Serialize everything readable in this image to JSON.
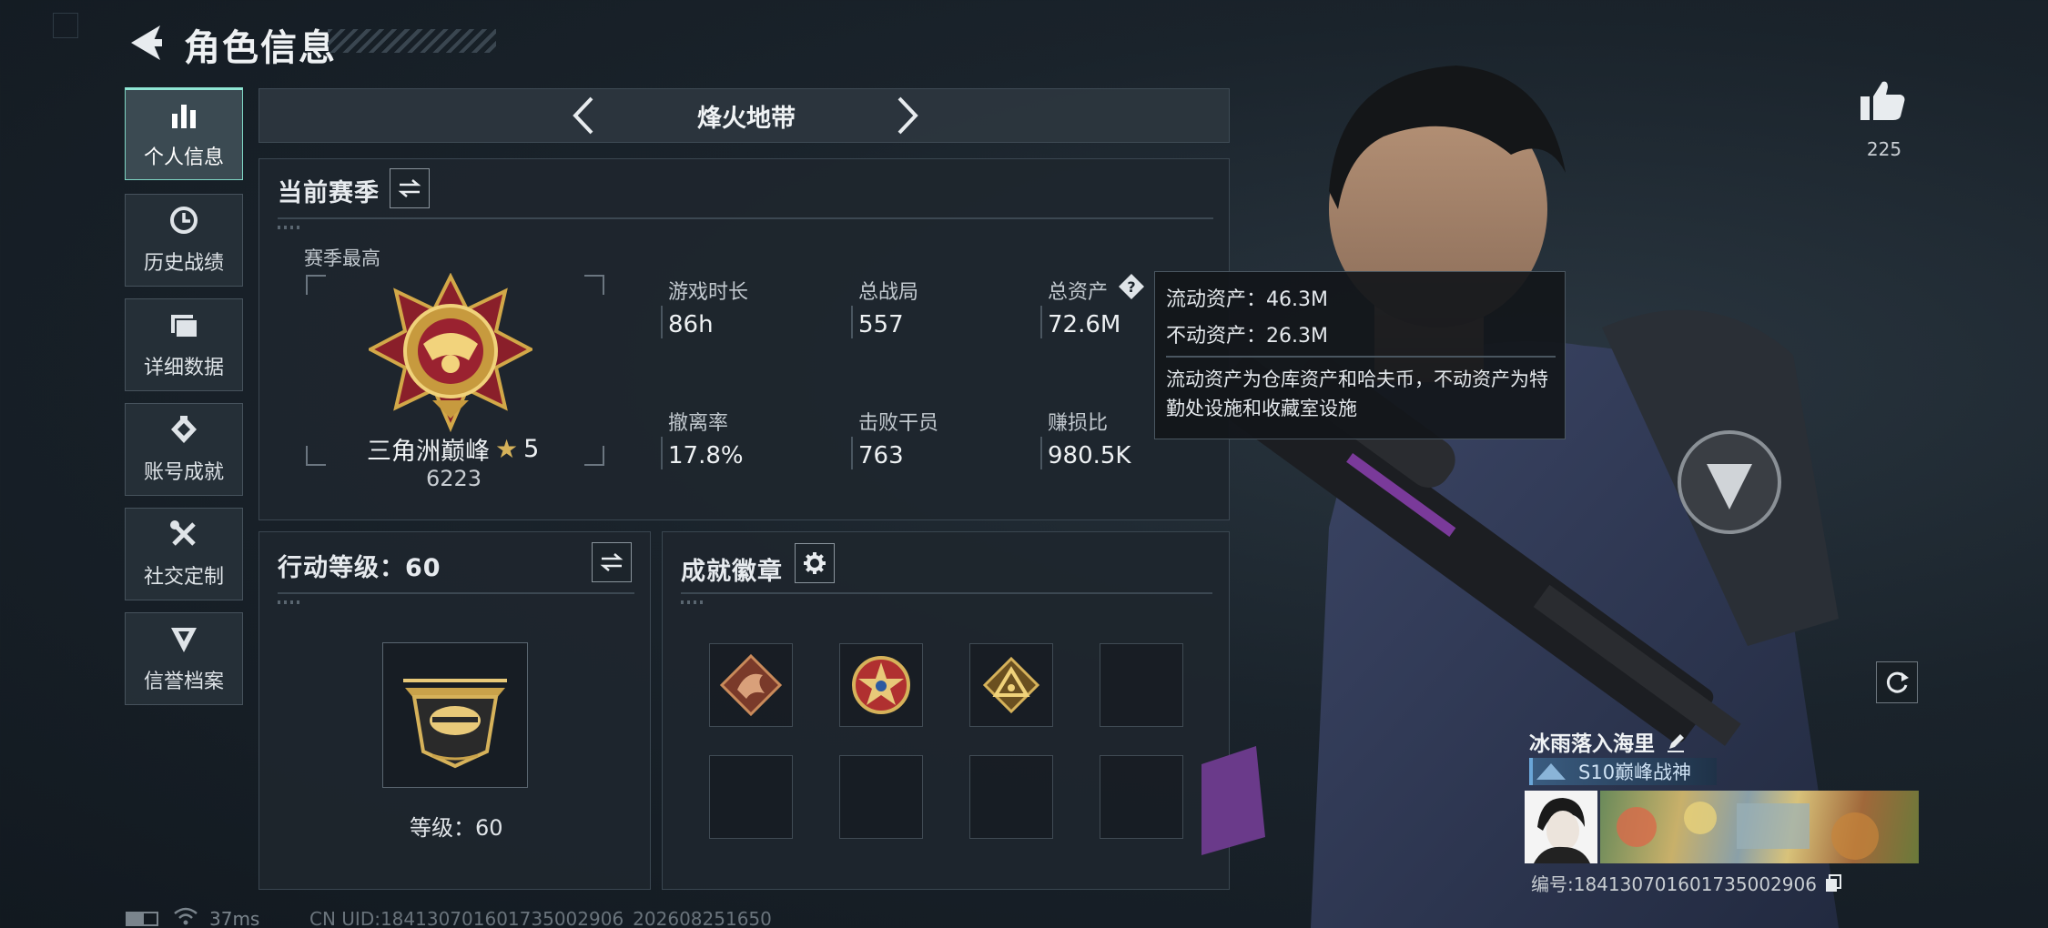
{
  "header": {
    "title": "角色信息"
  },
  "mode_selector": {
    "label": "烽火地带"
  },
  "sidebar": {
    "items": [
      {
        "label": "个人信息",
        "icon": "bar-chart-icon",
        "active": true
      },
      {
        "label": "历史战绩",
        "icon": "history-icon",
        "active": false
      },
      {
        "label": "详细数据",
        "icon": "folder-icon",
        "active": false
      },
      {
        "label": "账号成就",
        "icon": "medal-icon",
        "active": false
      },
      {
        "label": "社交定制",
        "icon": "tools-icon",
        "active": false
      },
      {
        "label": "信誉档案",
        "icon": "shield-icon",
        "active": false
      }
    ]
  },
  "season": {
    "title": "当前赛季",
    "best_label": "赛季最高",
    "rank_name": "三角洲巅峰",
    "rank_stars": "5",
    "rank_points": "6223",
    "stats": [
      {
        "label": "游戏时长",
        "value": "86h"
      },
      {
        "label": "总战局",
        "value": "557"
      },
      {
        "label": "总资产",
        "value": "72.6M"
      },
      {
        "label": "撤离率",
        "value": "17.8%"
      },
      {
        "label": "击败干员",
        "value": "763"
      },
      {
        "label": "赚损比",
        "value": "980.5K"
      }
    ]
  },
  "tooltip": {
    "liquid": "流动资产：46.3M",
    "fixed": "不动资产：26.3M",
    "description": "流动资产为仓库资产和哈夫币，不动资产为特勤处设施和收藏室设施"
  },
  "action_level": {
    "title": "行动等级：60",
    "level_text": "等级：60"
  },
  "badges": {
    "title": "成就徽章"
  },
  "likes": {
    "count": "225"
  },
  "player": {
    "name": "冰雨落入海里",
    "title_badge": "S10巅峰战神",
    "id_text": "编号:184130701601735002906"
  },
  "footer": {
    "ping": "37ms",
    "uid": "CN UID:184130701601735002906_202608251650"
  },
  "colors": {
    "accent": "#8fe6d4",
    "gold": "#c9a24a",
    "title_badge_bg": "#2e4a66"
  }
}
